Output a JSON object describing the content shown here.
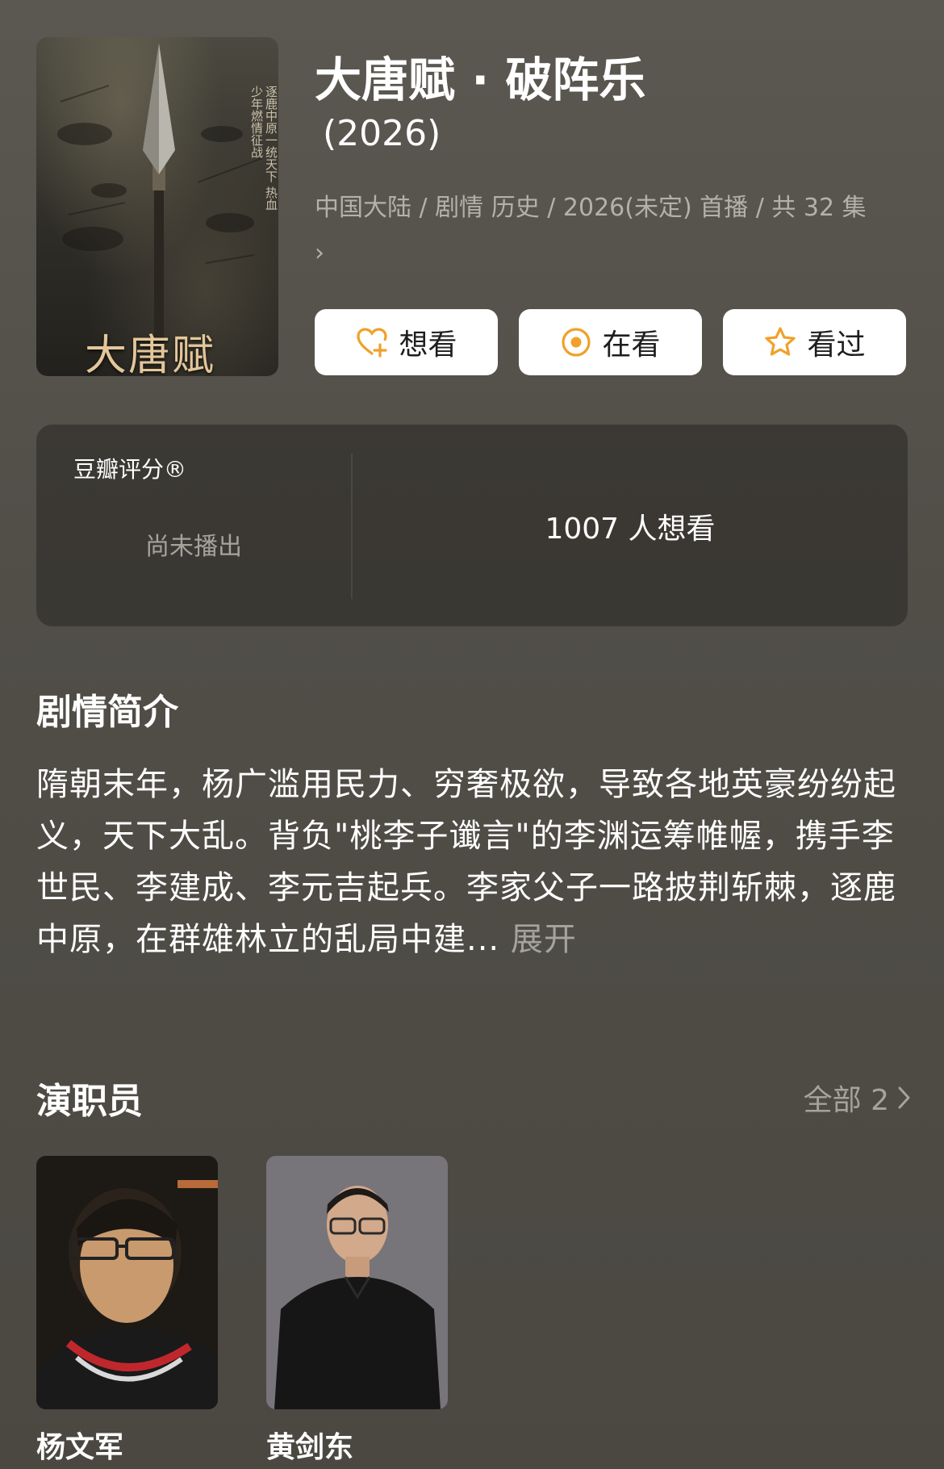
{
  "poster": {
    "title": "大唐赋",
    "tagline": "逐鹿中原一统天下 热血少年燃情征战"
  },
  "show": {
    "title": "大唐赋 · 破阵乐",
    "year": "(2026)",
    "meta": "中国大陆 / 剧情 历史 / 2026(未定) 首播 / 共 32 集",
    "meta_chevron": "›"
  },
  "actions": {
    "want_label": "想看",
    "watching_label": "在看",
    "watched_label": "看过"
  },
  "rating": {
    "label": "豆瓣评分®",
    "status": "尚未播出",
    "want_count": "1007 人想看"
  },
  "synopsis": {
    "title": "剧情简介",
    "text": "隋朝末年，杨广滥用民力、穷奢极欲，导致各地英豪纷纷起义，天下大乱。背负\"桃李子谶言\"的李渊运筹帷幄，携手李世民、李建成、李元吉起兵。李家父子一路披荆斩棘，逐鹿中原，在群雄林立的乱局中建...",
    "expand_label": "展开"
  },
  "cast": {
    "title": "演职员",
    "see_all_label": "全部 2",
    "members": [
      {
        "name": "杨文军"
      },
      {
        "name": "黄剑东"
      }
    ]
  },
  "colors": {
    "accent": "#f0a12a",
    "background": "#55524b",
    "muted_text": "#b4b1aa"
  }
}
